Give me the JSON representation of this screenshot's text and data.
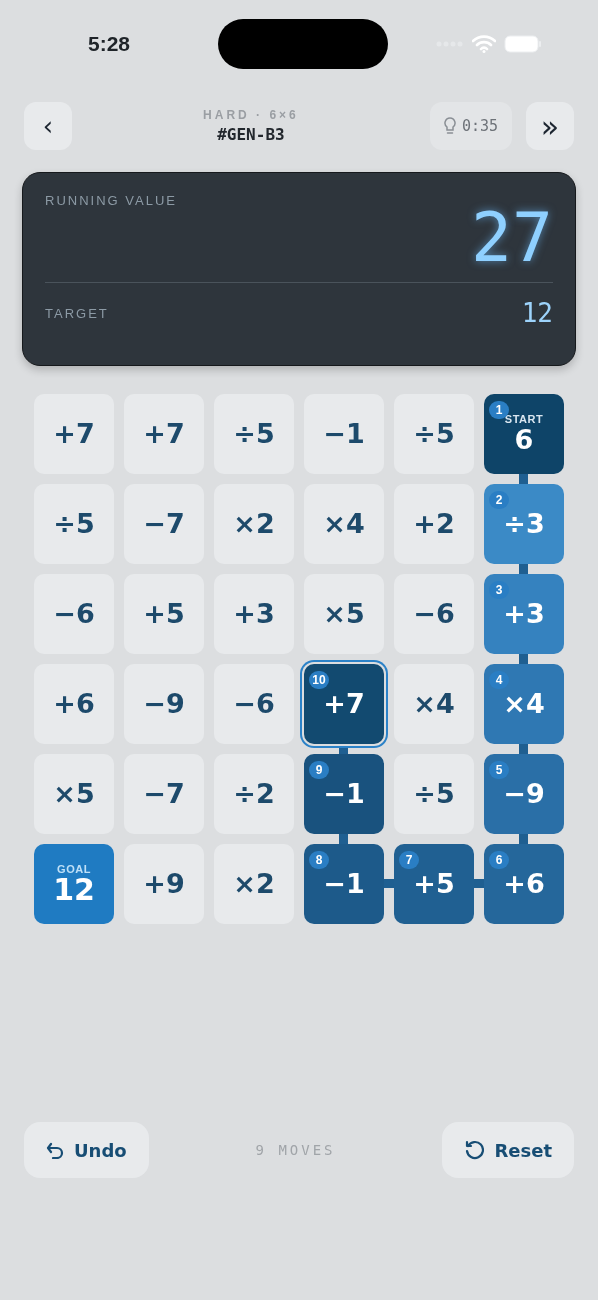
{
  "status_bar": {
    "time": "5:28"
  },
  "header": {
    "back": "‹",
    "difficulty": "HARD · 6×6",
    "puzzle_id": "#GEN-B3",
    "timer": "0:35",
    "skip": "»"
  },
  "display": {
    "running_label": "RUNNING VALUE",
    "running_value": "27",
    "target_label": "TARGET",
    "target_value": "12"
  },
  "grid": {
    "rows": [
      [
        {
          "kind": "plain",
          "label": "+7",
          "selected": false
        },
        {
          "kind": "plain",
          "label": "+7",
          "selected": false
        },
        {
          "kind": "plain",
          "label": "÷5",
          "selected": false
        },
        {
          "kind": "plain",
          "label": "−1",
          "selected": false
        },
        {
          "kind": "plain",
          "label": "÷5",
          "selected": false
        },
        {
          "kind": "start",
          "label": "6",
          "caption": "START",
          "step": "1",
          "color": "#0e4468",
          "selected": false
        }
      ],
      [
        {
          "kind": "plain",
          "label": "÷5",
          "selected": false
        },
        {
          "kind": "plain",
          "label": "−7",
          "selected": false
        },
        {
          "kind": "plain",
          "label": "×2",
          "selected": false
        },
        {
          "kind": "plain",
          "label": "×4",
          "selected": false
        },
        {
          "kind": "plain",
          "label": "+2",
          "selected": false
        },
        {
          "kind": "path",
          "label": "÷3",
          "step": "2",
          "color": "#3b8ac6",
          "selected": false
        }
      ],
      [
        {
          "kind": "plain",
          "label": "−6",
          "selected": false
        },
        {
          "kind": "plain",
          "label": "+5",
          "selected": false
        },
        {
          "kind": "plain",
          "label": "+3",
          "selected": false
        },
        {
          "kind": "plain",
          "label": "×5",
          "selected": false
        },
        {
          "kind": "plain",
          "label": "−6",
          "selected": false
        },
        {
          "kind": "path",
          "label": "+3",
          "step": "3",
          "color": "#3582bf",
          "selected": false
        }
      ],
      [
        {
          "kind": "plain",
          "label": "+6",
          "selected": false
        },
        {
          "kind": "plain",
          "label": "−9",
          "selected": false
        },
        {
          "kind": "plain",
          "label": "−6",
          "selected": false
        },
        {
          "kind": "path",
          "label": "+7",
          "step": "10",
          "color": "#124a70",
          "selected": true
        },
        {
          "kind": "plain",
          "label": "×4",
          "selected": false
        },
        {
          "kind": "path",
          "label": "×4",
          "step": "4",
          "color": "#2f78b3",
          "selected": false
        }
      ],
      [
        {
          "kind": "plain",
          "label": "×5",
          "selected": false
        },
        {
          "kind": "plain",
          "label": "−7",
          "selected": false
        },
        {
          "kind": "plain",
          "label": "÷2",
          "selected": false
        },
        {
          "kind": "path",
          "label": "−1",
          "step": "9",
          "color": "#19527e",
          "selected": false
        },
        {
          "kind": "plain",
          "label": "÷5",
          "selected": false
        },
        {
          "kind": "path",
          "label": "−9",
          "step": "5",
          "color": "#2a6fa7",
          "selected": false
        }
      ],
      [
        {
          "kind": "goal",
          "label": "12",
          "caption": "GOAL",
          "color": "#1f7bc2",
          "selected": false
        },
        {
          "kind": "plain",
          "label": "+9",
          "selected": false
        },
        {
          "kind": "plain",
          "label": "×2",
          "selected": false
        },
        {
          "kind": "path",
          "label": "−1",
          "step": "8",
          "color": "#1d5a8a",
          "selected": false
        },
        {
          "kind": "path",
          "label": "+5",
          "step": "7",
          "color": "#206092",
          "selected": false
        },
        {
          "kind": "path",
          "label": "+6",
          "step": "6",
          "color": "#25679b",
          "selected": false
        }
      ]
    ]
  },
  "footer": {
    "undo": "Undo",
    "moves": "9 MOVES",
    "reset": "Reset"
  }
}
